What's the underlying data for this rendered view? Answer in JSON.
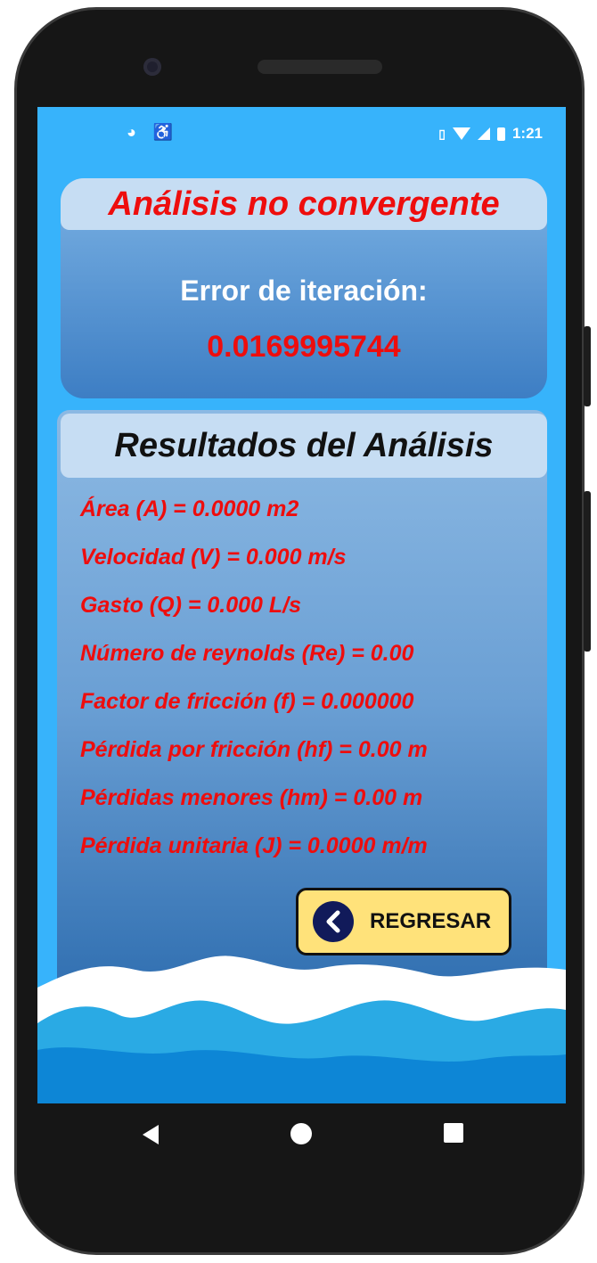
{
  "status_bar": {
    "time": "1:21",
    "left_icons": [
      "app-notification-icon",
      "accessibility-icon"
    ],
    "right_icons": [
      "vibrate-icon",
      "wifi-icon",
      "signal-icon",
      "battery-icon"
    ]
  },
  "status_card": {
    "title": "Análisis no convergente",
    "error_label": "Error de iteración:",
    "error_value": "0.0169995744"
  },
  "results_card": {
    "title": "Resultados del Análisis",
    "items": [
      "Área (A) = 0.0000 m2",
      "Velocidad (V) = 0.000 m/s",
      "Gasto (Q) = 0.000 L/s",
      "Número de reynolds (Re) = 0.00",
      "Factor de fricción (f) = 0.000000",
      "Pérdida por fricción (hf) = 0.00 m",
      "Pérdidas menores (hm) = 0.00 m",
      "Pérdida unitaria (J) = 0.0000 m/m"
    ]
  },
  "back_button": {
    "label": "REGRESAR",
    "icon": "chevron-left-icon"
  },
  "colors": {
    "screen_background": "#37b3fb",
    "accent_red": "#ee0d0d",
    "button_yellow": "#ffe27a",
    "header_bar": "#c6ddf3"
  },
  "nav_bar": {
    "icons": [
      "nav-back-icon",
      "nav-home-icon",
      "nav-recent-icon"
    ]
  }
}
